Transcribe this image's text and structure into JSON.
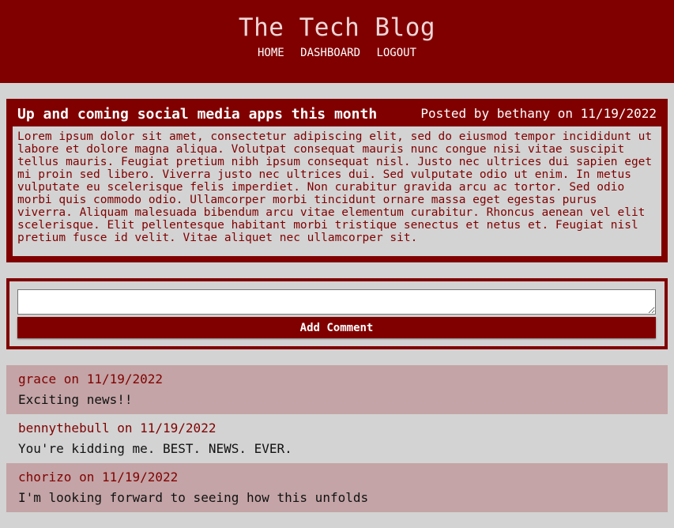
{
  "header": {
    "title": "The Tech Blog",
    "nav": [
      "HOME",
      "DASHBOARD",
      "LOGOUT"
    ]
  },
  "post": {
    "title": "Up and coming social media apps this month",
    "meta": "Posted by bethany on 11/19/2022",
    "body": "Lorem ipsum dolor sit amet, consectetur adipiscing elit, sed do eiusmod tempor incididunt ut labore et dolore magna aliqua. Volutpat consequat mauris nunc congue nisi vitae suscipit tellus mauris. Feugiat pretium nibh ipsum consequat nisl. Justo nec ultrices dui sapien eget mi proin sed libero. Viverra justo nec ultrices dui. Sed vulputate odio ut enim. In metus vulputate eu scelerisque felis imperdiet. Non curabitur gravida arcu ac tortor. Sed odio morbi quis commodo odio. Ullamcorper morbi tincidunt ornare massa eget egestas purus viverra. Aliquam malesuada bibendum arcu vitae elementum curabitur. Rhoncus aenean vel elit scelerisque. Elit pellentesque habitant morbi tristique senectus et netus et. Feugiat nisl pretium fusce id velit. Vitae aliquet nec ullamcorper sit."
  },
  "comment_form": {
    "value": "",
    "button_label": "Add Comment"
  },
  "comments": [
    {
      "meta": "grace on 11/19/2022",
      "text": "Exciting news!!"
    },
    {
      "meta": "bennythebull on 11/19/2022",
      "text": "You're kidding me. BEST. NEWS. EVER."
    },
    {
      "meta": "chorizo on 11/19/2022",
      "text": "I'm looking forward to seeing how this unfolds"
    }
  ],
  "colors": {
    "brand": "#800000",
    "background": "#d3d3d3",
    "comment_shade": "#c4a4a6"
  }
}
